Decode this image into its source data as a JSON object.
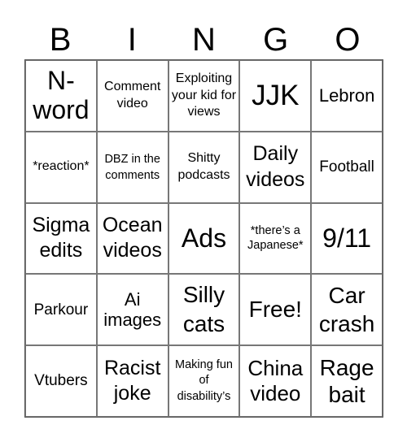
{
  "header": {
    "letters": [
      "B",
      "I",
      "N",
      "G",
      "O"
    ]
  },
  "cells": [
    "N-word",
    "Comment video",
    "Exploiting your kid for views",
    "JJK",
    "Lebron",
    "*reaction*",
    "DBZ in the comments",
    "Shitty podcasts",
    "Daily videos",
    "Football",
    "Sigma edits",
    "Ocean videos",
    "Ads",
    "*there’s a Japanese*",
    "9/11",
    "Parkour",
    "Ai images",
    "Silly cats",
    "Free!",
    "Car crash",
    "Vtubers",
    "Racist joke",
    "Making fun of disability’s",
    "China video",
    "Rage bait"
  ]
}
